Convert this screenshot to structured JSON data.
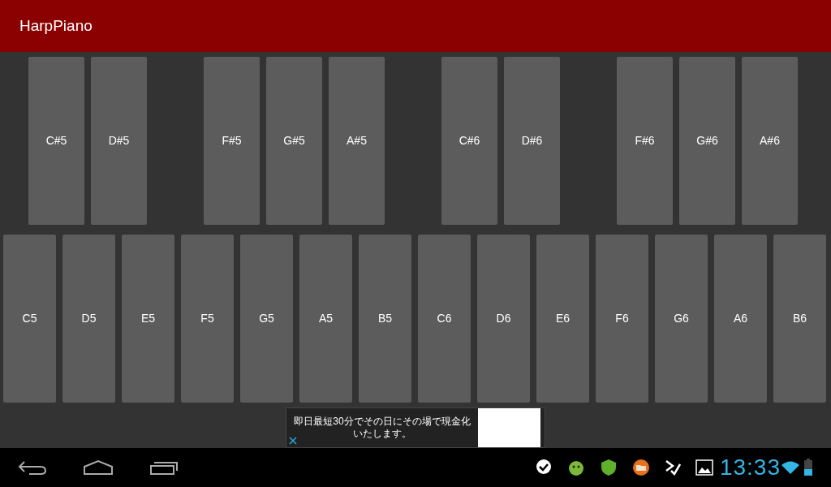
{
  "app_bar": {
    "title": "HarpPiano"
  },
  "black_key_groups": [
    [
      "C#5",
      "D#5"
    ],
    [
      "F#5",
      "G#5",
      "A#5"
    ],
    [
      "C#6",
      "D#6"
    ],
    [
      "F#6",
      "G#6",
      "A#6"
    ]
  ],
  "white_keys": [
    "C5",
    "D5",
    "E5",
    "F5",
    "G5",
    "A5",
    "B5",
    "C6",
    "D6",
    "E6",
    "F6",
    "G6",
    "A6",
    "B6"
  ],
  "ad": {
    "text": "即日最短30分でその日にその場で現金化いたします。"
  },
  "status_bar": {
    "time": "13:33"
  }
}
